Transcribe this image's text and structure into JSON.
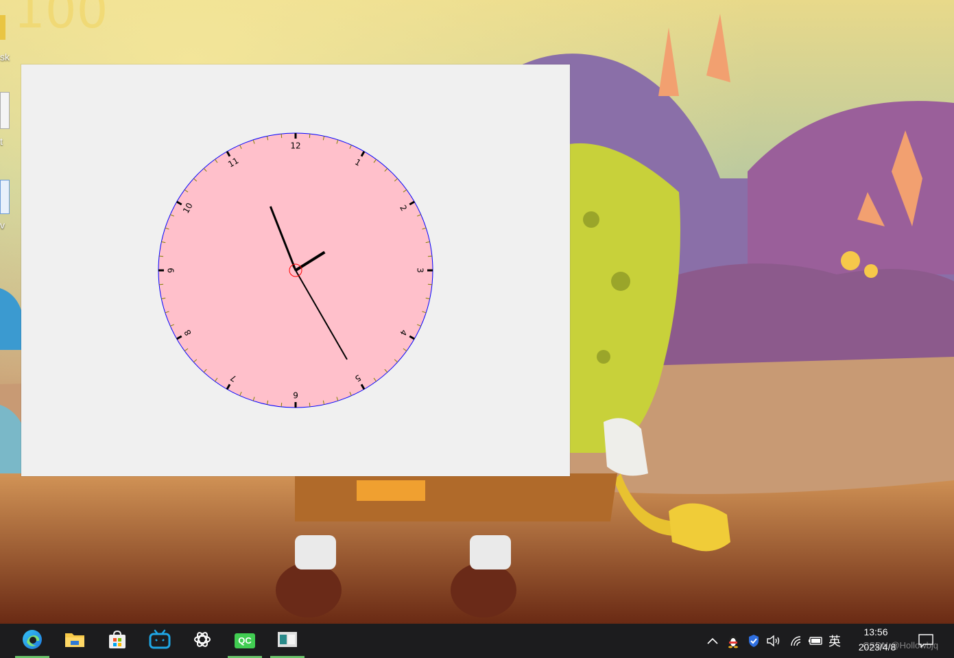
{
  "desktop": {
    "icon_labels": [
      "sk",
      "t",
      "v"
    ]
  },
  "clock": {
    "face_color": "#ffc0cb",
    "rim_color": "#0000ff",
    "tick_color": "#808000",
    "hand_color": "#000000",
    "center_color": "#ff0000",
    "numbers": [
      "12",
      "1",
      "2",
      "3",
      "4",
      "5",
      "6",
      "7",
      "8",
      "9",
      "10",
      "11"
    ],
    "displayed_time": {
      "hour": 1,
      "minute": 56,
      "second": 25
    }
  },
  "taskbar": {
    "apps": [
      {
        "name": "edge",
        "running": true
      },
      {
        "name": "file-explorer",
        "running": false
      },
      {
        "name": "microsoft-store",
        "running": false
      },
      {
        "name": "bilibili",
        "running": false
      },
      {
        "name": "chatgpt",
        "running": false
      },
      {
        "name": "qt-creator",
        "label": "QC",
        "running": true
      },
      {
        "name": "clock-app",
        "running": true
      }
    ],
    "tray": {
      "ime": "英",
      "time": "13:56",
      "date": "2023/4/8"
    },
    "watermark": "CSDN @Hollowbjq"
  }
}
